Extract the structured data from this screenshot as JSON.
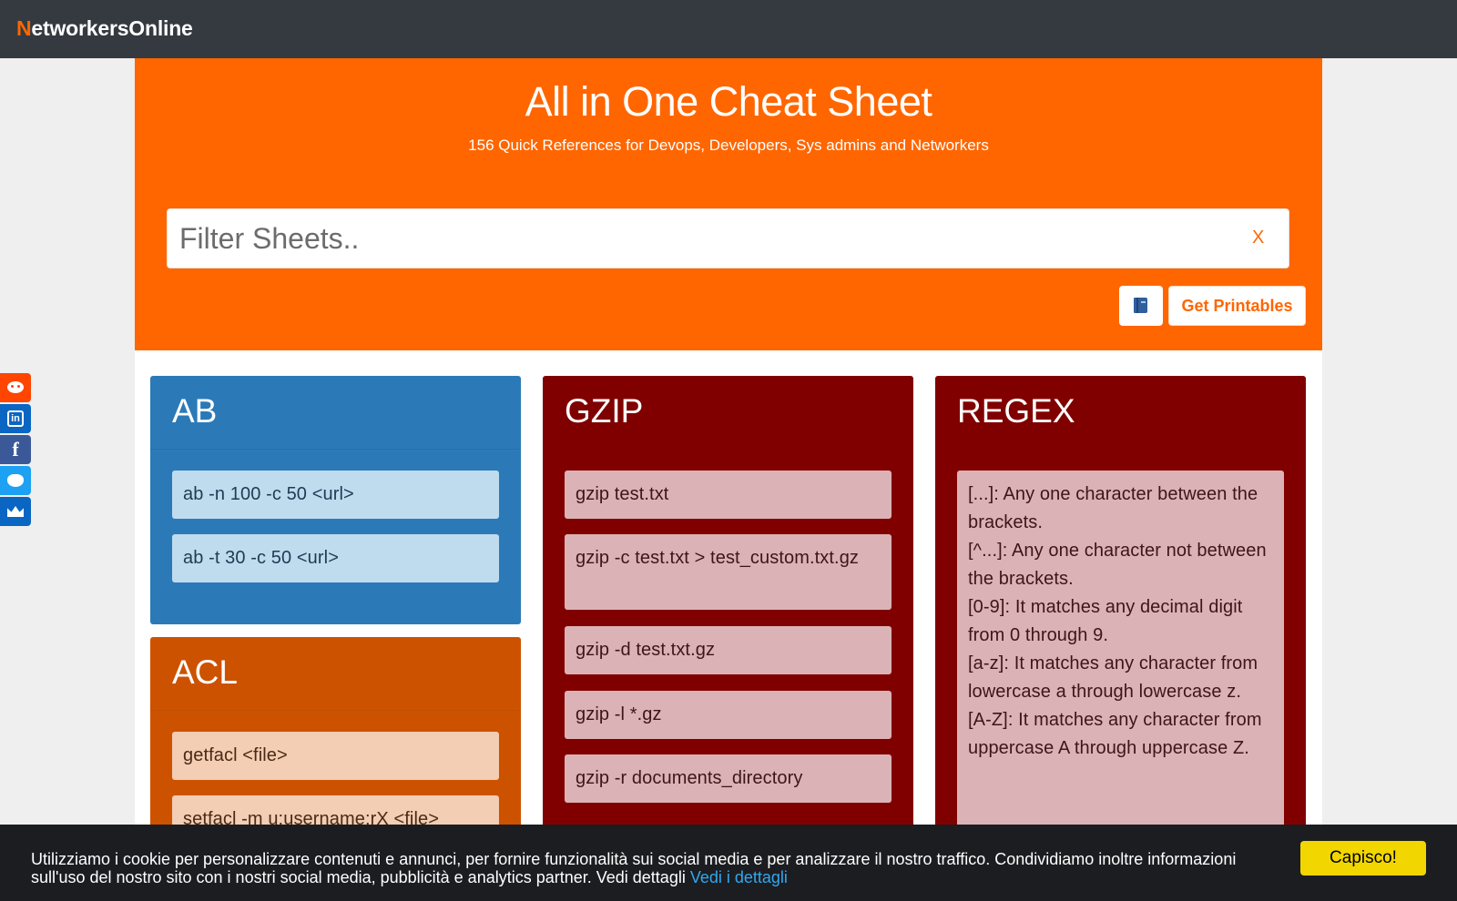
{
  "navbar": {
    "brand_first": "N",
    "brand_rest": "etworkersOnline"
  },
  "hero": {
    "title": "All in One Cheat Sheet",
    "subtitle": "156 Quick References for Devops, Developers, Sys admins and Networkers"
  },
  "filter": {
    "placeholder": "Filter Sheets..",
    "clear_label": "X"
  },
  "actions": {
    "book_icon": "book-icon",
    "printables_label": "Get Printables"
  },
  "cards": [
    {
      "title": "AB",
      "color": "#2b7ab7",
      "items": [
        "ab -n 100 -c 50 <url>",
        "ab -t 30 -c 50 <url>"
      ]
    },
    {
      "title": "ACL",
      "color": "#cc5200",
      "items": [
        "getfacl <file>",
        "setfacl -m u:username:rX <file>"
      ]
    },
    {
      "title": "GZIP",
      "color": "#800000",
      "items": [
        "gzip test.txt",
        "gzip -c test.txt > test_custom.txt.gz",
        "gzip -d test.txt.gz",
        "gzip -l *.gz",
        "gzip -r documents_directory"
      ]
    },
    {
      "title": "REGEX",
      "color": "#800000",
      "items": [
        "[...]: Any one character between the brackets.\n[^...]: Any one character not between the brackets.\n[0-9]: It matches any decimal digit from 0 through 9.\n[a-z]: It matches any character from lowercase a through lowercase z.\n[A-Z]: It matches any character from uppercase A through uppercase Z."
      ]
    }
  ],
  "social": [
    {
      "name": "reddit",
      "color": "#ff4500"
    },
    {
      "name": "linkedin",
      "color": "#0a66c2"
    },
    {
      "name": "facebook",
      "color": "#3b5998"
    },
    {
      "name": "twitter",
      "color": "#1da1f2"
    },
    {
      "name": "crown",
      "color": "#0a66c2"
    }
  ],
  "cookie": {
    "message": "Utilizziamo i cookie per personalizzare contenuti e annunci, per fornire funzionalità sui social media e per analizzare il nostro traffico. Condividiamo inoltre informazioni sull'uso del nostro sito con i nostri social media, pubblicità e analytics partner. Vedi dettagli ",
    "link": "Vedi i dettagli",
    "accept": "Capisco!"
  },
  "colors": {
    "accent": "#ff6600",
    "navbar": "#343a40",
    "cookie_button": "#f1d600"
  }
}
